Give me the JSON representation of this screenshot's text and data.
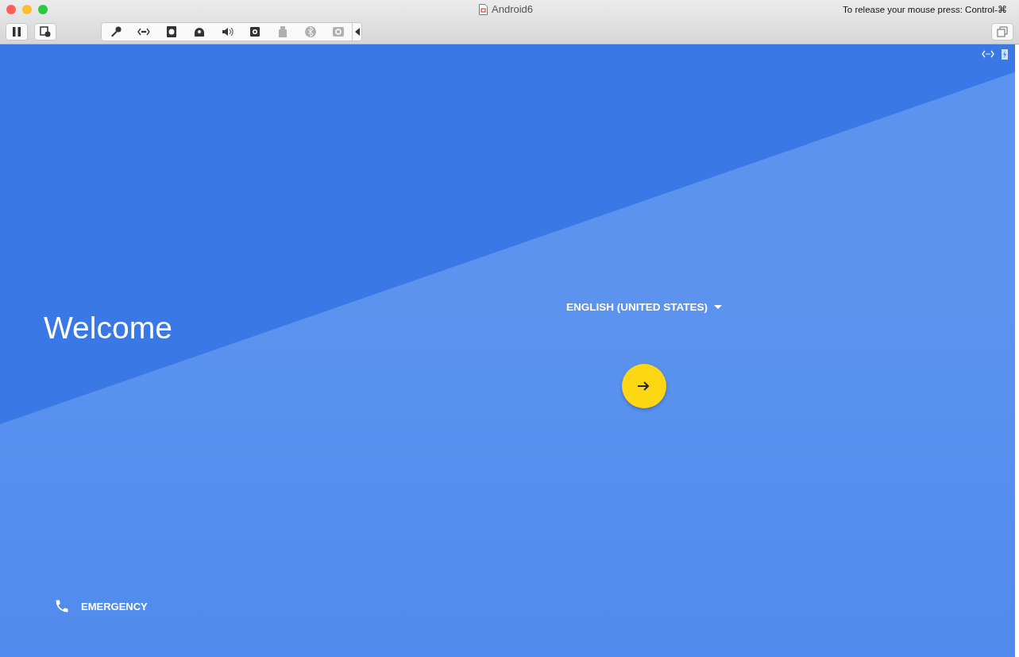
{
  "window": {
    "title": "Android6",
    "release_hint": "To release your mouse press: Control-⌘"
  },
  "toolbar_tools": [
    {
      "disabled": false
    },
    {
      "disabled": false
    },
    {
      "disabled": false
    },
    {
      "disabled": false
    },
    {
      "disabled": false
    },
    {
      "disabled": false
    },
    {
      "disabled": true
    },
    {
      "disabled": true
    },
    {
      "disabled": true
    }
  ],
  "screen": {
    "heading": "Welcome",
    "language": "ENGLISH (UNITED STATES)",
    "emergency": "EMERGENCY"
  }
}
